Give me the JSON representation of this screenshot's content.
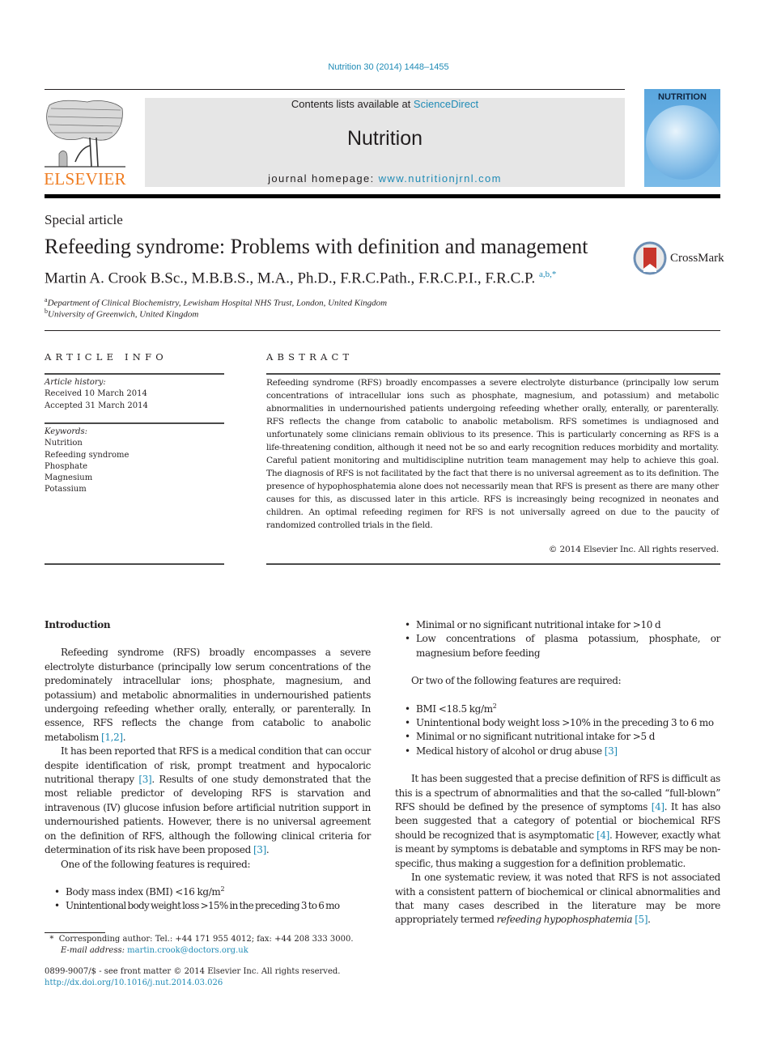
{
  "header": {
    "citation": "Nutrition 30 (2014) 1448–1455",
    "publisher_logo_text": "ELSEVIER",
    "contents_prefix": "Contents lists available at ",
    "contents_link": "ScienceDirect",
    "journal_name": "Nutrition",
    "homepage_prefix": "journal homepage: ",
    "homepage_link": "www.nutritionjrnl.com",
    "cover_title": "NUTRITION",
    "colors": {
      "link": "#1f8bb6",
      "elsevier_orange": "#ef7d22",
      "masthead_bg": "#e6e6e6"
    }
  },
  "article": {
    "type": "Special article",
    "title": "Refeeding syndrome: Problems with definition and management",
    "author": "Martin A. Crook B.Sc., M.B.B.S., M.A., Ph.D., F.R.C.Path., F.R.C.P.I., F.R.C.P.",
    "author_marks": "a,b,*",
    "crossmark_label": "CrossMark",
    "affiliations": [
      {
        "mark": "a",
        "text": "Department of Clinical Biochemistry, Lewisham Hospital NHS Trust, London, United Kingdom"
      },
      {
        "mark": "b",
        "text": "University of Greenwich, United Kingdom"
      }
    ]
  },
  "article_info": {
    "heading": "ARTICLE INFO",
    "history_label": "Article history:",
    "received": "Received 10 March 2014",
    "accepted": "Accepted 31 March 2014",
    "keywords_label": "Keywords:",
    "keywords": [
      "Nutrition",
      "Refeeding syndrome",
      "Phosphate",
      "Magnesium",
      "Potassium"
    ]
  },
  "abstract": {
    "heading": "ABSTRACT",
    "text": "Refeeding syndrome (RFS) broadly encompasses a severe electrolyte disturbance (principally low serum concentrations of intracellular ions such as phosphate, magnesium, and potassium) and metabolic abnormalities in undernourished patients undergoing refeeding whether orally, enterally, or parenterally. RFS reflects the change from catabolic to anabolic metabolism. RFS sometimes is undiagnosed and unfortunately some clinicians remain oblivious to its presence. This is particularly concerning as RFS is a life-threatening condition, although it need not be so and early recognition reduces morbidity and mortality. Careful patient monitoring and multidiscipline nutrition team management may help to achieve this goal. The diagnosis of RFS is not facilitated by the fact that there is no universal agreement as to its definition. The presence of hypophosphatemia alone does not necessarily mean that RFS is present as there are many other causes for this, as discussed later in this article. RFS is increasingly being recognized in neonates and children. An optimal refeeding regimen for RFS is not universally agreed on due to the paucity of randomized controlled trials in the field.",
    "copyright": "© 2014 Elsevier Inc. All rights reserved."
  },
  "body": {
    "intro_heading": "Introduction",
    "p1_text": "Refeeding syndrome (RFS) broadly encompasses a severe electrolyte disturbance (principally low serum concentrations of the predominately intracellular ions; phosphate, magnesium, and potassium) and metabolic abnormalities in undernourished patients undergoing refeeding whether orally, enterally, or parenterally. In essence, RFS reflects the change from catabolic to anabolic metabolism ",
    "p1_ref": "[1,2]",
    "p2_a": "It has been reported that RFS is a medical condition that can occur despite identification of risk, prompt treatment and hypocaloric nutritional therapy ",
    "p2_ref1": "[3]",
    "p2_b": ". Results of one study demonstrated that the most reliable predictor of developing RFS is starvation and intravenous (IV) glucose infusion before artificial nutrition support in undernourished patients. However, there is no universal agreement on the definition of RFS, although the following clinical criteria for determination of its risk have been proposed ",
    "p2_ref2": "[3]",
    "one_required": "One of the following features is required:",
    "list_one": [
      {
        "text": "Body mass index (BMI) <16 kg/m",
        "sup": "2"
      },
      {
        "text": "Unintentional body weight loss >15% in the preceding 3 to 6 mo"
      },
      {
        "text": "Minimal or no significant nutritional intake for >10 d"
      },
      {
        "text": "Low concentrations of plasma potassium, phosphate, or magnesium before feeding"
      }
    ],
    "two_required": "Or two of the following features are required:",
    "list_two": [
      {
        "text": "BMI <18.5 kg/m",
        "sup": "2"
      },
      {
        "text": "Unintentional body weight loss >10% in the preceding 3 to 6 mo"
      },
      {
        "text": "Minimal or no significant nutritional intake for >5 d"
      },
      {
        "text": "Medical history of alcohol or drug abuse ",
        "ref": "[3]"
      }
    ],
    "p3_a": "It has been suggested that a precise definition of RFS is difficult as this is a spectrum of abnormalities and that the so-called “full-blown” RFS should be defined by the presence of symptoms ",
    "p3_ref1": "[4]",
    "p3_b": ". It has also been suggested that a category of potential or biochemical RFS should be recognized that is asymptomatic ",
    "p3_ref2": "[4]",
    "p3_c": ". However, exactly what is meant by symptoms is debatable and symptoms in RFS may be non-specific, thus making a suggestion for a definition problematic.",
    "p4_a": "In one systematic review, it was noted that RFS is not associated with a consistent pattern of biochemical or clinical abnormalities and that many cases described in the literature may be more appropriately termed ",
    "p4_em": "refeeding hypophosphatemia",
    "p4_ref": "[5]"
  },
  "footnote": {
    "mark": "*",
    "corresponding": "Corresponding author: Tel.: +44 171 955 4012; fax: +44 208 333 3000.",
    "email_label": "E-mail address: ",
    "email": "martin.crook@doctors.org.uk",
    "issn_line": "0899-9007/$ - see front matter © 2014 Elsevier Inc. All rights reserved.",
    "doi": "http://dx.doi.org/10.1016/j.nut.2014.03.026"
  }
}
